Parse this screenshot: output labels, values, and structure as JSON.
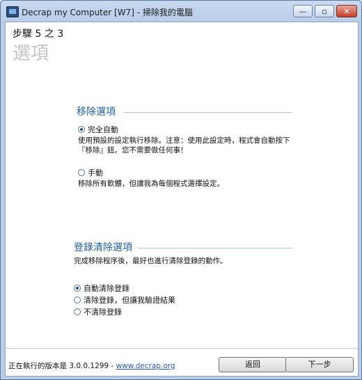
{
  "window": {
    "title": "Decrap my Computer [W7] - 掃除我的電腦",
    "controls": {
      "minimize": "—",
      "maximize": "▫",
      "close": "✕"
    }
  },
  "header": {
    "step": "步驟 5 之 3",
    "title": "選項"
  },
  "remove_options": {
    "title": "移除選項",
    "options": [
      {
        "label": "完全自動",
        "selected": true,
        "description": "使用預設的設定執行移除。注意：使用此設定時，程式會自動按下『移除』鈕。您不需要做任何事！"
      },
      {
        "label": "手動",
        "selected": false,
        "description": "移除所有軟體，但讓我為每個程式選擇設定。"
      }
    ]
  },
  "registry_options": {
    "title": "登錄清除選項",
    "description": "完成移除程序後，最好也進行清除登錄的動作。",
    "options": [
      {
        "label": "自動清除登錄",
        "selected": true
      },
      {
        "label": "清除登錄，但讓我驗證結果",
        "selected": false
      },
      {
        "label": "不清除登錄",
        "selected": false
      }
    ]
  },
  "footer": {
    "version_text": "正在執行的版本是 3.0.0.1299 - ",
    "link": "www.decrap.org",
    "back_label": "返回",
    "next_label": "下一步"
  }
}
